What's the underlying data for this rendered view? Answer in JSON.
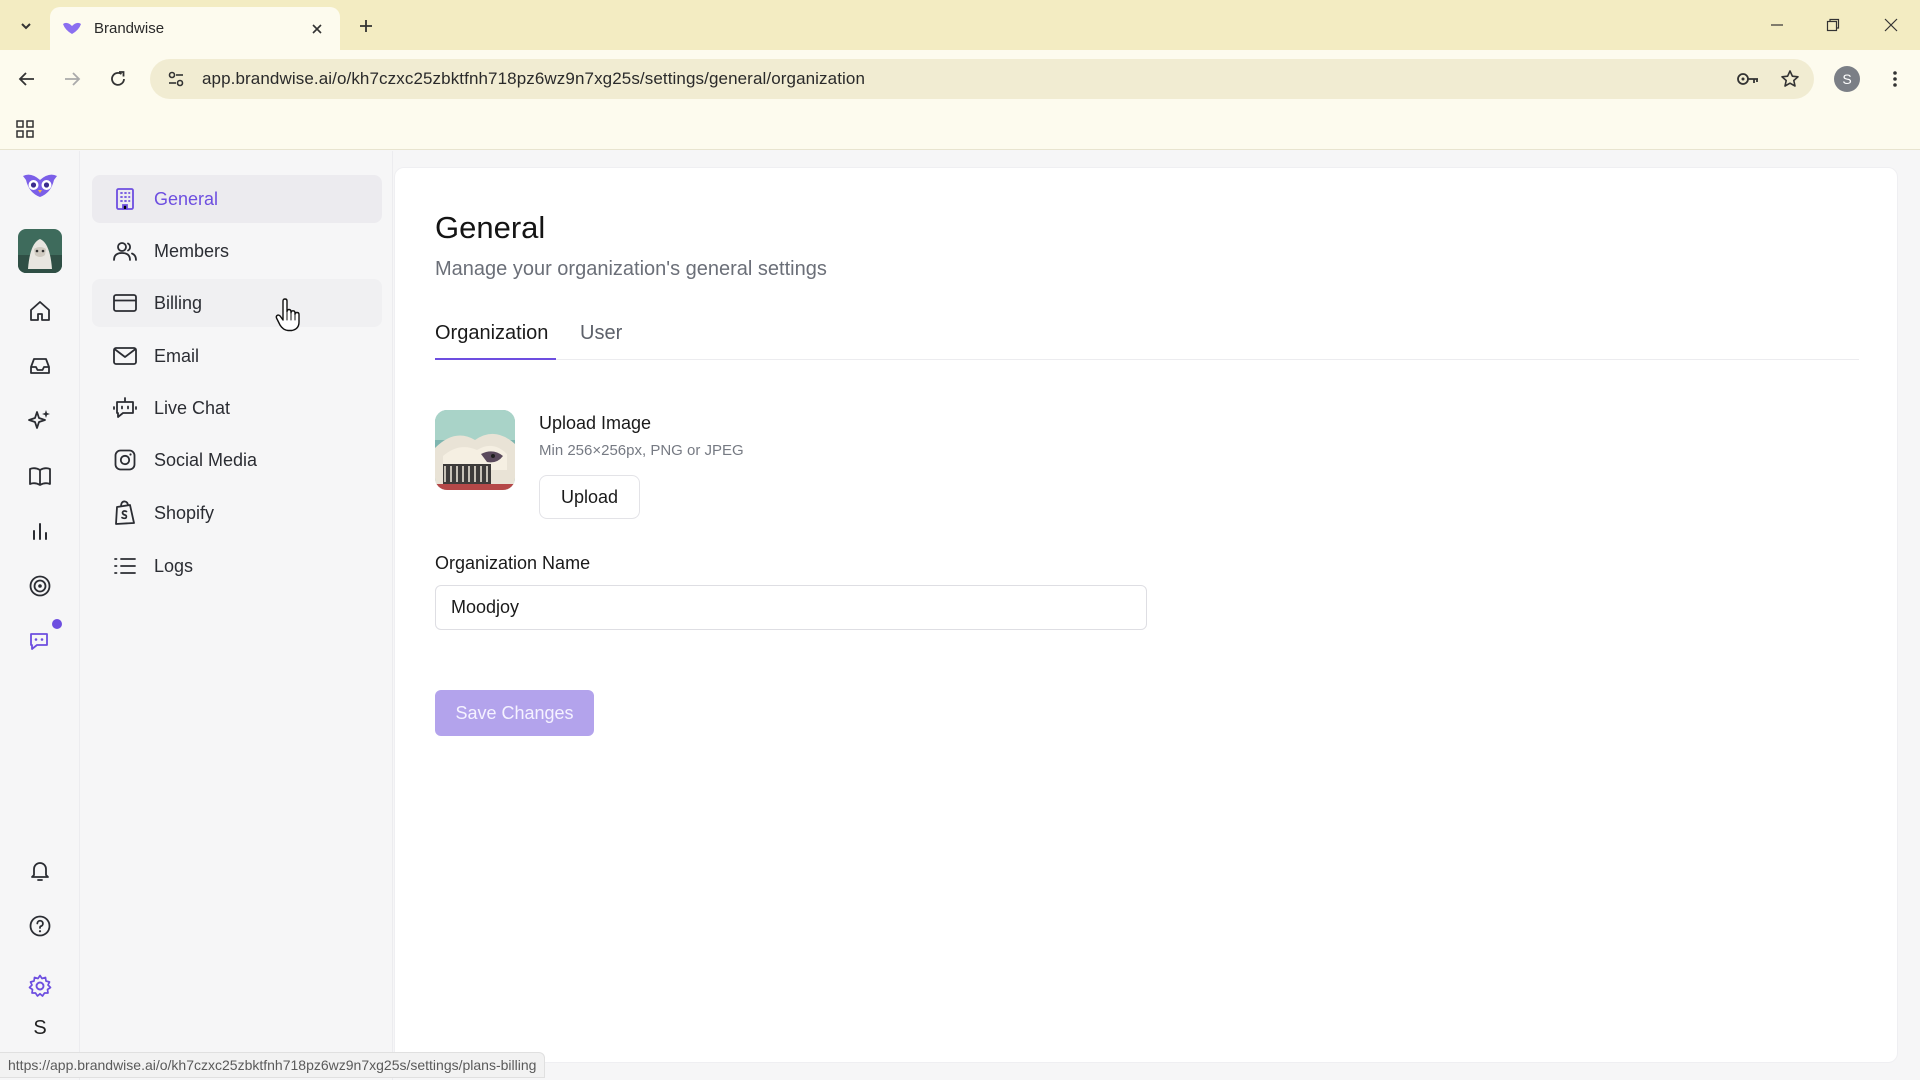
{
  "browser": {
    "tab_title": "Brandwise",
    "url": "app.brandwise.ai/o/kh7czxc25zbktfnh718pz6wz9n7xg25s/settings/general/organization",
    "profile_initial": "S",
    "status_url": "https://app.brandwise.ai/o/kh7czxc25zbktfnh718pz6wz9n7xg25s/settings/plans-billing"
  },
  "rail": {
    "icons": [
      "owl-logo-icon",
      "home-icon",
      "inbox-icon",
      "sparkles-icon",
      "book-icon",
      "bar-chart-icon",
      "target-icon",
      "chat-bot-icon",
      "bell-icon",
      "help-icon",
      "gear-icon"
    ],
    "user_initial": "S"
  },
  "settings_nav": {
    "items": [
      {
        "label": "General",
        "icon": "building-icon",
        "active": true
      },
      {
        "label": "Members",
        "icon": "users-icon"
      },
      {
        "label": "Billing",
        "icon": "credit-card-icon"
      },
      {
        "label": "Email",
        "icon": "mail-icon"
      },
      {
        "label": "Live Chat",
        "icon": "bot-icon"
      },
      {
        "label": "Social Media",
        "icon": "instagram-icon"
      },
      {
        "label": "Shopify",
        "icon": "shopify-icon"
      },
      {
        "label": "Logs",
        "icon": "list-icon"
      }
    ]
  },
  "main": {
    "title": "General",
    "subtitle": "Manage your organization's general settings",
    "tabs": [
      {
        "label": "Organization",
        "active": true
      },
      {
        "label": "User",
        "active": false
      }
    ],
    "upload": {
      "title": "Upload Image",
      "hint": "Min 256×256px, PNG or JPEG",
      "button": "Upload"
    },
    "org_name": {
      "label": "Organization Name",
      "value": "Moodjoy"
    },
    "save_button": "Save Changes"
  },
  "colors": {
    "accent": "#6d4ee0",
    "save_disabled": "#b3a3ec",
    "chrome_tabstrip": "#f3ecc2",
    "chrome_toolbar": "#fdfbee"
  }
}
